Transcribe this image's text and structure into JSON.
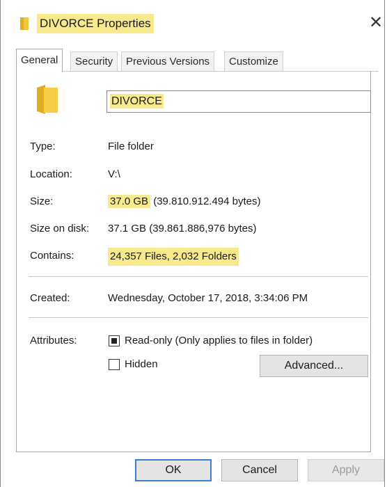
{
  "window": {
    "title": "DIVORCE Properties",
    "close_symbol": "✕",
    "icon": "folder-icon"
  },
  "tabs": [
    {
      "label": "General",
      "active": true
    },
    {
      "label": "Security",
      "active": false
    },
    {
      "label": "Previous Versions",
      "active": false
    },
    {
      "label": "Customize",
      "active": false
    }
  ],
  "general": {
    "name": "DIVORCE",
    "type": {
      "label": "Type:",
      "value": "File folder"
    },
    "location": {
      "label": "Location:",
      "value": "V:\\"
    },
    "size": {
      "label": "Size:",
      "value": "37.0 GB",
      "detail": "(39.810.912.494 bytes)"
    },
    "size_on_disk": {
      "label": "Size on disk:",
      "value": "37.1 GB (39.861.886,976 bytes)"
    },
    "contains": {
      "label": "Contains:",
      "value": "24,357 Files, 2,032 Folders"
    },
    "created": {
      "label": "Created:",
      "value": "Wednesday, October 17, 2018, 3:34:06 PM"
    },
    "attributes": {
      "label": "Attributes:",
      "readonly": {
        "label": "Read-only (Only applies to files in folder)",
        "state": "indeterminate"
      },
      "hidden": {
        "label": "Hidden",
        "checked": false
      },
      "advanced_label": "Advanced..."
    }
  },
  "buttons": {
    "ok": "OK",
    "cancel": "Cancel",
    "apply": "Apply"
  },
  "colors": {
    "highlight": "#f7ea8c",
    "folder": "#f2c63a",
    "focus_border": "#3b7fd1"
  }
}
